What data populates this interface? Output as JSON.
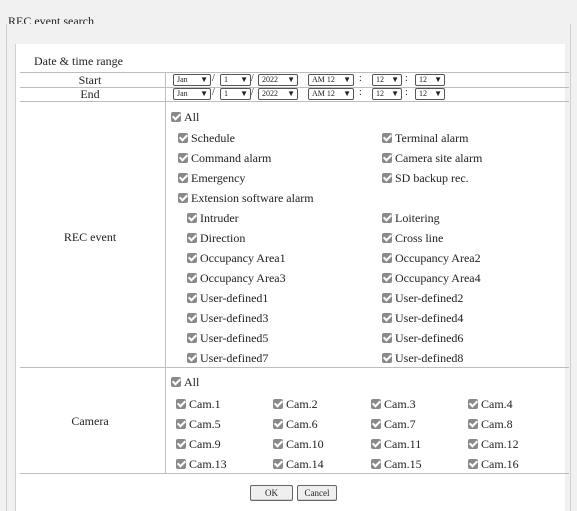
{
  "header": {
    "title": "REC event search"
  },
  "date_time": {
    "section_title": "Date & time range",
    "start": {
      "label": "Start",
      "month": "Jan",
      "day": "1",
      "year": "2022",
      "hour": "AM 12",
      "minute": "12",
      "second": "12"
    },
    "end": {
      "label": "End",
      "month": "Jan",
      "day": "1",
      "year": "2022",
      "hour": "AM 12",
      "minute": "12",
      "second": "12"
    },
    "date_sep": "/",
    "time_sep": ":"
  },
  "rec_event": {
    "label": "REC event",
    "all": "All",
    "schedule": "Schedule",
    "terminal_alarm": "Terminal alarm",
    "command_alarm": "Command alarm",
    "camera_site_alarm": "Camera site alarm",
    "emergency": "Emergency",
    "sd_backup": "SD backup rec.",
    "extension": "Extension software alarm",
    "intruder": "Intruder",
    "loitering": "Loitering",
    "direction": "Direction",
    "cross_line": "Cross line",
    "occ1": "Occupancy Area1",
    "occ2": "Occupancy Area2",
    "occ3": "Occupancy Area3",
    "occ4": "Occupancy Area4",
    "ud1": "User-defined1",
    "ud2": "User-defined2",
    "ud3": "User-defined3",
    "ud4": "User-defined4",
    "ud5": "User-defined5",
    "ud6": "User-defined6",
    "ud7": "User-defined7",
    "ud8": "User-defined8"
  },
  "camera": {
    "label": "Camera",
    "all": "All",
    "cams": [
      "Cam.1",
      "Cam.2",
      "Cam.3",
      "Cam.4",
      "Cam.5",
      "Cam.6",
      "Cam.7",
      "Cam.8",
      "Cam.9",
      "Cam.10",
      "Cam.11",
      "Cam.12",
      "Cam.13",
      "Cam.14",
      "Cam.15",
      "Cam.16"
    ]
  },
  "buttons": {
    "ok": "OK",
    "cancel": "Cancel"
  },
  "checkbox_state": "checked"
}
